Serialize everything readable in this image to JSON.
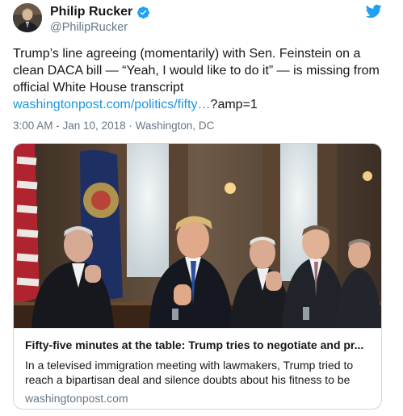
{
  "author": {
    "name": "Philip Rucker",
    "handle": "@PhilipRucker",
    "verified_icon": "verified-badge-icon",
    "avatar_icon": "avatar"
  },
  "tweet": {
    "text": "Trump’s line agreeing (momentarily) with Sen. Feinstein on a clean DACA bill — “Yeah, I would like to do it” — is missing from official White House transcript",
    "link_text": "washingtonpost.com/politics/fifty…",
    "link_tail": "?amp=1",
    "timestamp": "3:00 AM - Jan 10, 2018",
    "separator": "·",
    "location": "Washington, DC"
  },
  "card": {
    "title": "Fifty-five minutes at the table: Trump tries to negotiate and pr...",
    "description": "In a televised immigration meeting with lawmakers, Trump tried to reach a bipartisan deal and silence doubts about his fitness to be",
    "domain": "washingtonpost.com",
    "image_icon": "article-photo"
  },
  "colors": {
    "link": "#1b95e0",
    "text": "#14171a",
    "muted": "#657786",
    "border": "#ccd6dd"
  }
}
